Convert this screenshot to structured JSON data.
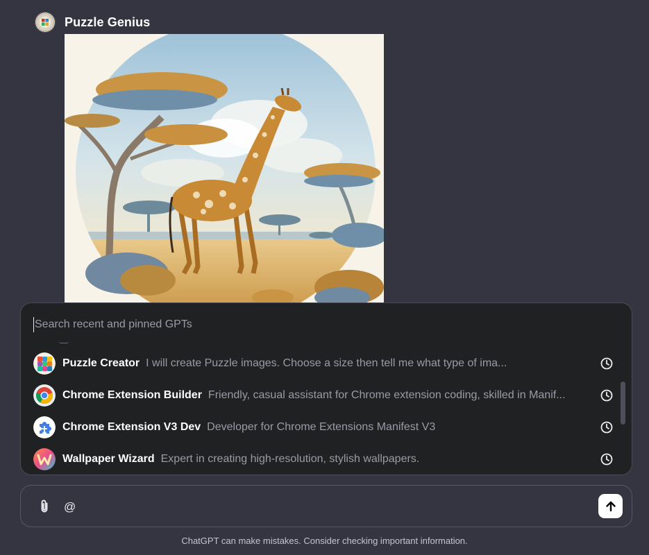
{
  "gpt": {
    "name": "Puzzle Genius",
    "avatar_icon": "puzzle-seal-icon"
  },
  "popup": {
    "search_placeholder": "Search recent and pinned GPTs",
    "items": [
      {
        "title": "Puzzle Creator",
        "description": "I will create Puzzle images. Choose a size then tell me what type of ima...",
        "avatar_icon": "colorful-puzzle-cube-icon",
        "action_icon": "clock-icon"
      },
      {
        "title": "Chrome Extension Builder",
        "description": "Friendly, casual assistant for Chrome extension coding, skilled in Manif...",
        "avatar_icon": "chrome-logo-icon",
        "action_icon": "clock-icon"
      },
      {
        "title": "Chrome Extension V3 Dev",
        "description": "Developer for Chrome Extensions Manifest V3",
        "avatar_icon": "blue-puzzle-piece-icon",
        "action_icon": "clock-icon"
      },
      {
        "title": "Wallpaper Wizard",
        "description": "Expert in creating high-resolution, stylish wallpapers.",
        "avatar_icon": "gradient-w-logo-icon",
        "action_icon": "clock-icon"
      }
    ]
  },
  "composer": {
    "value": "@",
    "attach_icon": "paperclip-icon",
    "send_icon": "arrow-up-icon"
  },
  "footer": {
    "disclaimer": "ChatGPT can make mistakes. Consider checking important information."
  },
  "colors": {
    "background": "#343541",
    "popup_background": "#202123",
    "text_primary": "#ffffff",
    "text_muted": "#9a9ba6"
  }
}
